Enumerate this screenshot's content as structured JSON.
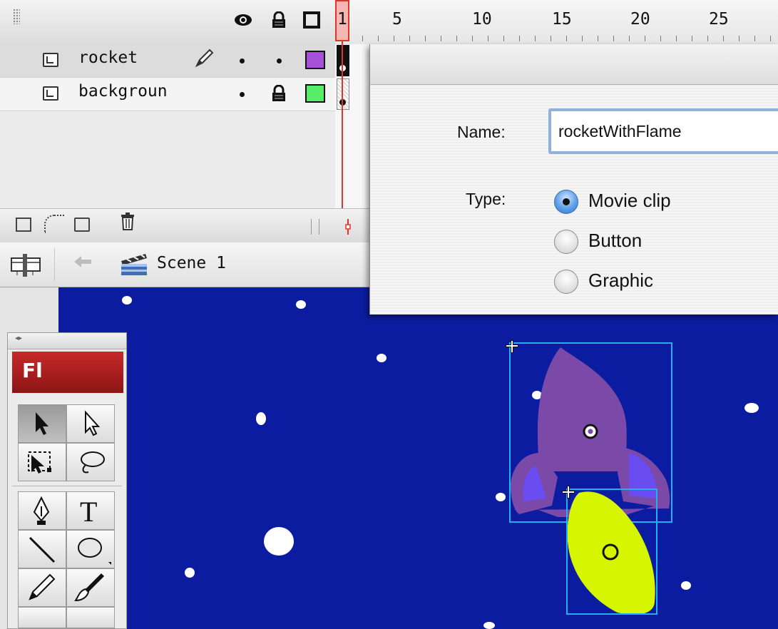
{
  "timeline": {
    "frame_numbers": [
      "1",
      "5",
      "10",
      "15",
      "20",
      "25"
    ],
    "layers": [
      {
        "name": "rocket",
        "color": "#a64fd9"
      },
      {
        "name": "backgroun",
        "color": "#55ee66"
      }
    ]
  },
  "editbar": {
    "scene_label": "Scene 1"
  },
  "tools": {
    "badge": "Fl",
    "items": [
      "selection-tool",
      "subselection-tool",
      "free-transform-tool",
      "lasso-tool",
      "pen-tool",
      "text-tool",
      "line-tool",
      "oval-tool",
      "pencil-tool",
      "brush-tool"
    ],
    "text_tool_glyph": "T"
  },
  "dialog": {
    "name_label": "Name:",
    "name_value": "rocketWithFlame",
    "type_label": "Type:",
    "type_options": [
      "Movie clip",
      "Button",
      "Graphic"
    ],
    "selected_type": "Movie clip"
  },
  "stage": {
    "background_color": "#0c1ca0",
    "rocket_color": "#7b4aa8",
    "fin_color": "#6a4df0",
    "flame_color": "#d6f500",
    "selection_color": "#22b0f0"
  }
}
